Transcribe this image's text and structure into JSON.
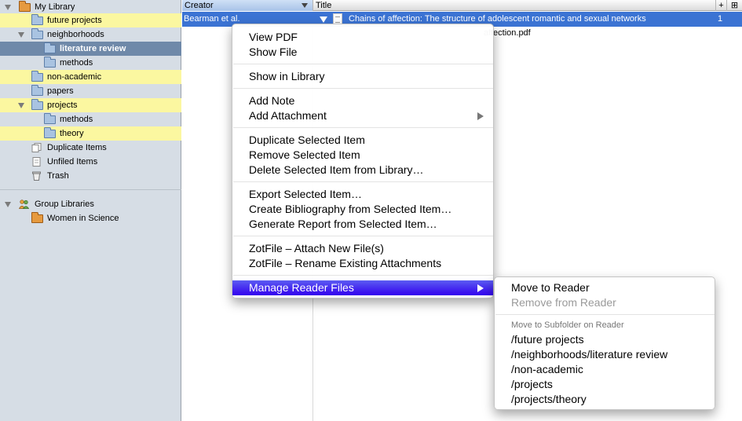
{
  "sidebar": {
    "my_library": "My Library",
    "folders": [
      "future projects",
      "neighborhoods",
      "literature review",
      "methods",
      "non-academic",
      "papers",
      "projects",
      "methods",
      "theory"
    ],
    "duplicate_items": "Duplicate Items",
    "unfiled_items": "Unfiled Items",
    "trash": "Trash",
    "group_libraries": "Group Libraries",
    "group": "Women in Science"
  },
  "columns": {
    "creator": "Creator",
    "title": "Title",
    "add": "+",
    "picker": "⊞"
  },
  "item": {
    "creator": "Bearman et al.",
    "title": "Chains of affection: The structure of adolescent romantic and sexual networks",
    "count": "1",
    "attachment_suffix": "affection.pdf"
  },
  "context_menu": {
    "items": [
      "View PDF",
      "Show File",
      "Show in Library",
      "Add Note",
      "Add Attachment",
      "Duplicate Selected Item",
      "Remove Selected Item",
      "Delete Selected Item from Library…",
      "Export Selected Item…",
      "Create Bibliography from Selected Item…",
      "Generate Report from Selected Item…",
      "ZotFile – Attach New File(s)",
      "ZotFile – Rename Existing Attachments",
      "Manage Reader Files"
    ]
  },
  "submenu": {
    "move": "Move to Reader",
    "remove": "Remove from Reader",
    "subfolder_header": "Move to Subfolder on Reader",
    "subfolders": [
      "/future projects",
      "/neighborhoods/literature review",
      "/non-academic",
      "/projects",
      "/projects/theory"
    ]
  },
  "colors": {
    "highlight": "#fbf7a0",
    "selected_row": "#3b73d3",
    "menu_active": "#3300ee",
    "sidebar_selected": "#6f89a9"
  }
}
